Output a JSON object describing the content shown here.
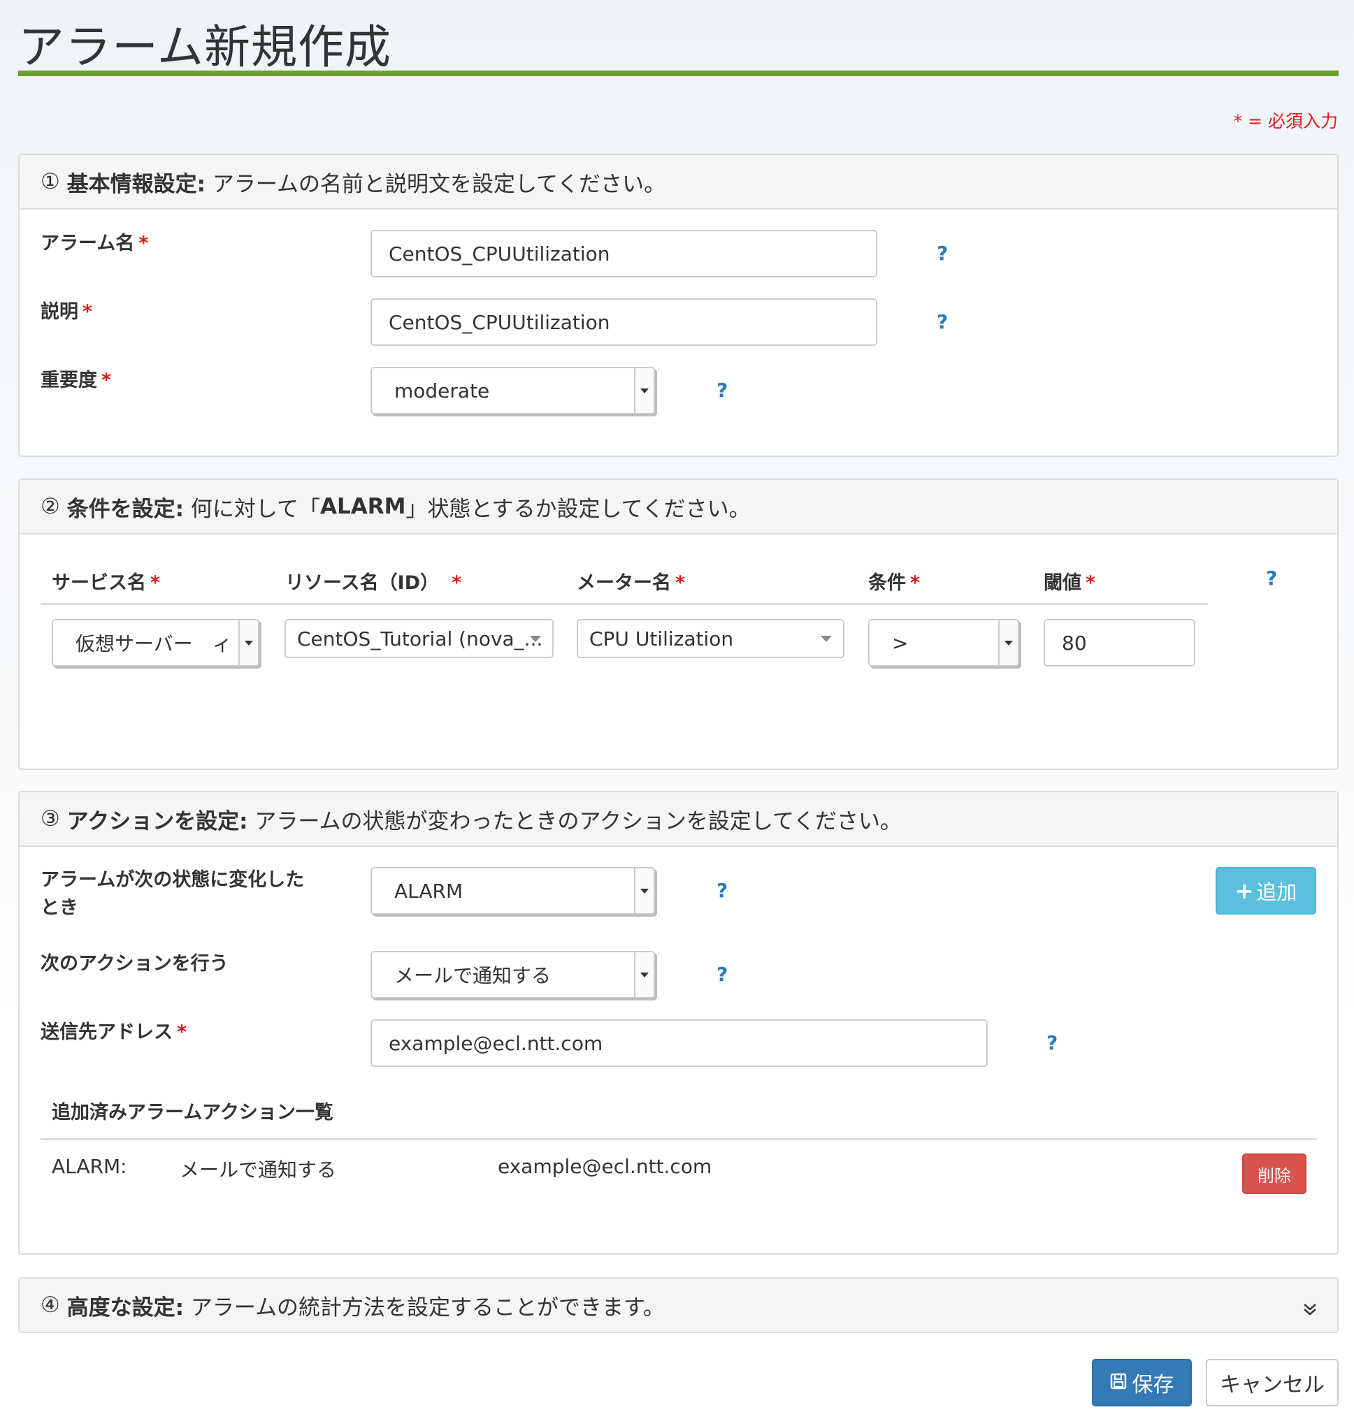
{
  "page": {
    "title": "アラーム新規作成",
    "required_note": "* = 必須入力"
  },
  "section1": {
    "heading_num": "①",
    "heading_bold": "基本情報設定:",
    "heading_rest": "アラームの名前と説明文を設定してください。",
    "alarm_name_label": "アラーム名",
    "alarm_name_value": "CentOS_CPUUtilization",
    "description_label": "説明",
    "description_value": "CentOS_CPUUtilization",
    "severity_label": "重要度",
    "severity_value": "moderate"
  },
  "section2": {
    "heading_num": "②",
    "heading_bold": "条件を設定:",
    "heading_pre": "何に対して「",
    "heading_alarm": "ALARM",
    "heading_post": "」状態とするか設定してください。",
    "col_service": "サービス名",
    "col_resource": "リソース名（ID）",
    "col_meter": "メーター名",
    "col_condition": "条件",
    "col_threshold": "閾値",
    "service_value": "仮想サーバー　ィ",
    "resource_value": "CentOS_Tutorial (nova_...",
    "meter_value": "CPU Utilization",
    "condition_value": ">",
    "threshold_value": "80"
  },
  "section3": {
    "heading_num": "③",
    "heading_bold": "アクションを設定:",
    "heading_rest": "アラームの状態が変わったときのアクションを設定してください。",
    "state_label_line1": "アラームが次の状態に変化した",
    "state_label_line2": "とき",
    "state_value": "ALARM",
    "action_label": "次のアクションを行う",
    "action_value": "メールで通知する",
    "address_label": "送信先アドレス",
    "address_value": "example@ecl.ntt.com",
    "add_button": "追加",
    "list_title": "追加済みアラームアクション一覧",
    "rows": [
      {
        "state": "ALARM:",
        "action": "メールで通知する",
        "address": "example@ecl.ntt.com",
        "delete": "削除"
      }
    ]
  },
  "section4": {
    "heading_num": "④",
    "heading_bold": "高度な設定:",
    "heading_rest": "アラームの統計方法を設定することができます。"
  },
  "footer": {
    "save_label": "保存",
    "cancel_label": "キャンセル"
  },
  "common": {
    "required_mark": "*",
    "help_mark": "?"
  }
}
